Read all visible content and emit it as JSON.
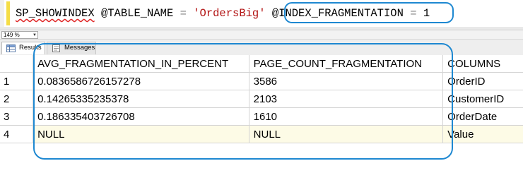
{
  "editor": {
    "procedure": "SP_SHOWINDEX",
    "param1_name": "@TABLE_NAME",
    "equals": "=",
    "param1_value": "'OrdersBig'",
    "param2_name": "@INDEX_FRAGMENTATION",
    "param2_value": "1"
  },
  "zoom": {
    "value": "149 %"
  },
  "tabs": [
    {
      "label": "Results",
      "icon": "grid-icon"
    },
    {
      "label": "Messages",
      "icon": "messages-icon"
    }
  ],
  "grid": {
    "columns": [
      "AVG_FRAGMENTATION_IN_PERCENT",
      "PAGE_COUNT_FRAGMENTATION",
      "COLUMNS"
    ],
    "rows": [
      {
        "num": "1",
        "cells": [
          "0.0836586726157278",
          "3586",
          "OrderID"
        ]
      },
      {
        "num": "2",
        "cells": [
          "0.14265335235378",
          "2103",
          "CustomerID"
        ]
      },
      {
        "num": "3",
        "cells": [
          "0.186335403726708",
          "1610",
          "OrderDate"
        ]
      },
      {
        "num": "4",
        "cells": [
          "NULL",
          "NULL",
          "Value"
        ]
      }
    ]
  },
  "colors": {
    "callout": "#1e88d1",
    "string": "#b21212",
    "null_row": "#fdfbe6",
    "change_bar": "#f5dd46"
  }
}
